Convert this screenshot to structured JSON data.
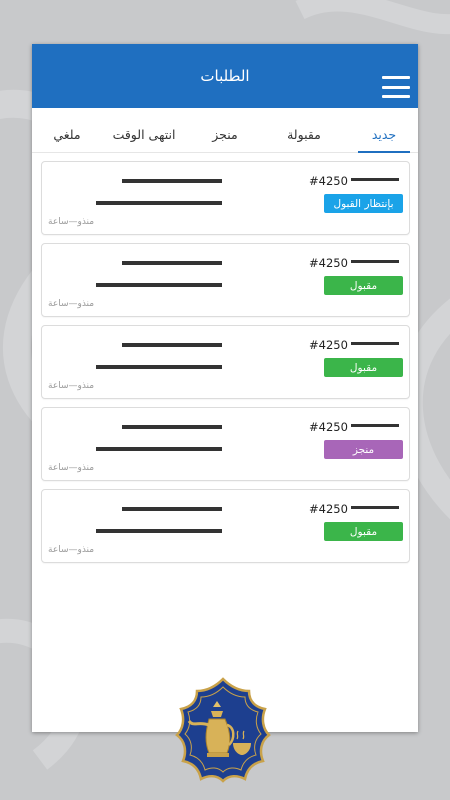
{
  "header": {
    "title": "الطلبات"
  },
  "tabs": [
    {
      "label": "جديد",
      "active": true
    },
    {
      "label": "مقبولة",
      "active": false
    },
    {
      "label": "منجز",
      "active": false
    },
    {
      "label": "انتهى الوقت",
      "active": false
    },
    {
      "label": "ملغي",
      "active": false
    }
  ],
  "orders": [
    {
      "id": "#4250",
      "status": "بإنتظار القبول",
      "status_color": "#1aa3e8",
      "time": "منذو—ساعة"
    },
    {
      "id": "#4250",
      "status": "مقبول",
      "status_color": "#3bb54a",
      "time": "منذو—ساعة"
    },
    {
      "id": "#4250",
      "status": "مقبول",
      "status_color": "#3bb54a",
      "time": "منذو—ساعة"
    },
    {
      "id": "#4250",
      "status": "منجز",
      "status_color": "#a866b8",
      "time": "منذو—ساعة"
    },
    {
      "id": "#4250",
      "status": "مقبول",
      "status_color": "#3bb54a",
      "time": "منذو—ساعة"
    }
  ],
  "colors": {
    "brand": "#1f6fc0",
    "emblem_blue": "#1d3f8f",
    "emblem_gold": "#c9a24a"
  },
  "icons": {
    "menu": "hamburger-menu-icon",
    "logo": "dallah-coffee-emblem-icon"
  }
}
